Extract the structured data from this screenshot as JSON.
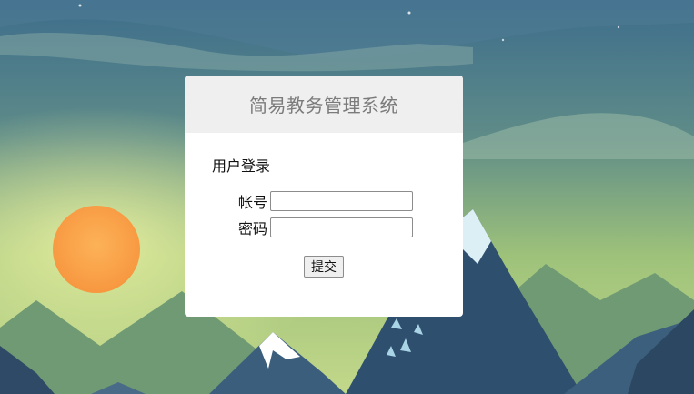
{
  "app": {
    "title": "简易教务管理系统"
  },
  "login": {
    "heading": "用户登录",
    "account_label": "帐号",
    "account_value": "",
    "password_label": "密码",
    "password_value": "",
    "submit_label": "提交"
  },
  "colors": {
    "sky_top": "#3e6f8e",
    "sky_bottom": "#b9d27a",
    "sun": "#f8a14a",
    "mountain_dark": "#2f4d6b",
    "mountain_mid": "#4b6e8a",
    "hill_green": "#8fb06c",
    "card_header": "#efefef",
    "title_text": "#7b7b7b"
  }
}
